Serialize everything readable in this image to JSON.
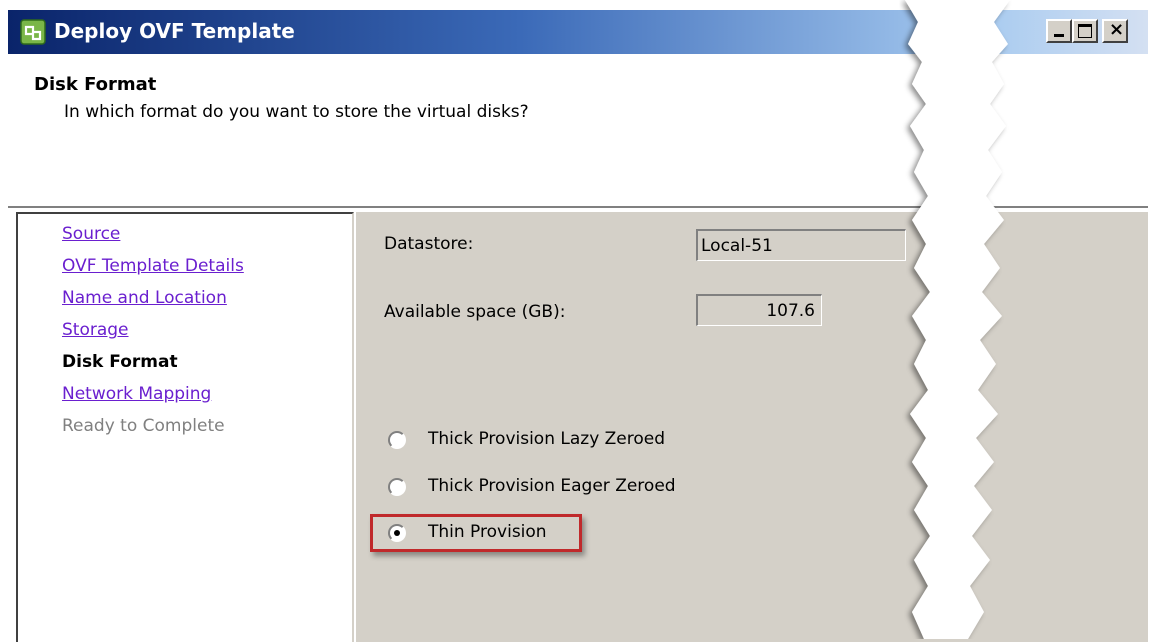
{
  "window": {
    "title": "Deploy OVF Template",
    "close_glyph": "×"
  },
  "header": {
    "title": "Disk Format",
    "subtitle": "In which format do you want to store the virtual disks?"
  },
  "nav": {
    "items": [
      {
        "label": "Source",
        "state": "link"
      },
      {
        "label": "OVF Template Details",
        "state": "link"
      },
      {
        "label": "Name and Location",
        "state": "link"
      },
      {
        "label": "Storage",
        "state": "link"
      },
      {
        "label": "Disk Format",
        "state": "current"
      },
      {
        "label": "Network Mapping",
        "state": "link"
      },
      {
        "label": "Ready to Complete",
        "state": "disabled"
      }
    ]
  },
  "content": {
    "datastore_label": "Datastore:",
    "datastore_value": "Local-51",
    "space_label": "Available space (GB):",
    "space_value": "107.6",
    "options": [
      {
        "label": "Thick Provision Lazy Zeroed",
        "checked": false
      },
      {
        "label": "Thick Provision Eager Zeroed",
        "checked": false
      },
      {
        "label": "Thin Provision",
        "checked": true
      }
    ]
  },
  "colors": {
    "highlight": "#c0292b",
    "link": "#6a1fcf",
    "panel_bg": "#d4d0c8"
  },
  "icons": {
    "app": "vsphere-app-icon"
  }
}
